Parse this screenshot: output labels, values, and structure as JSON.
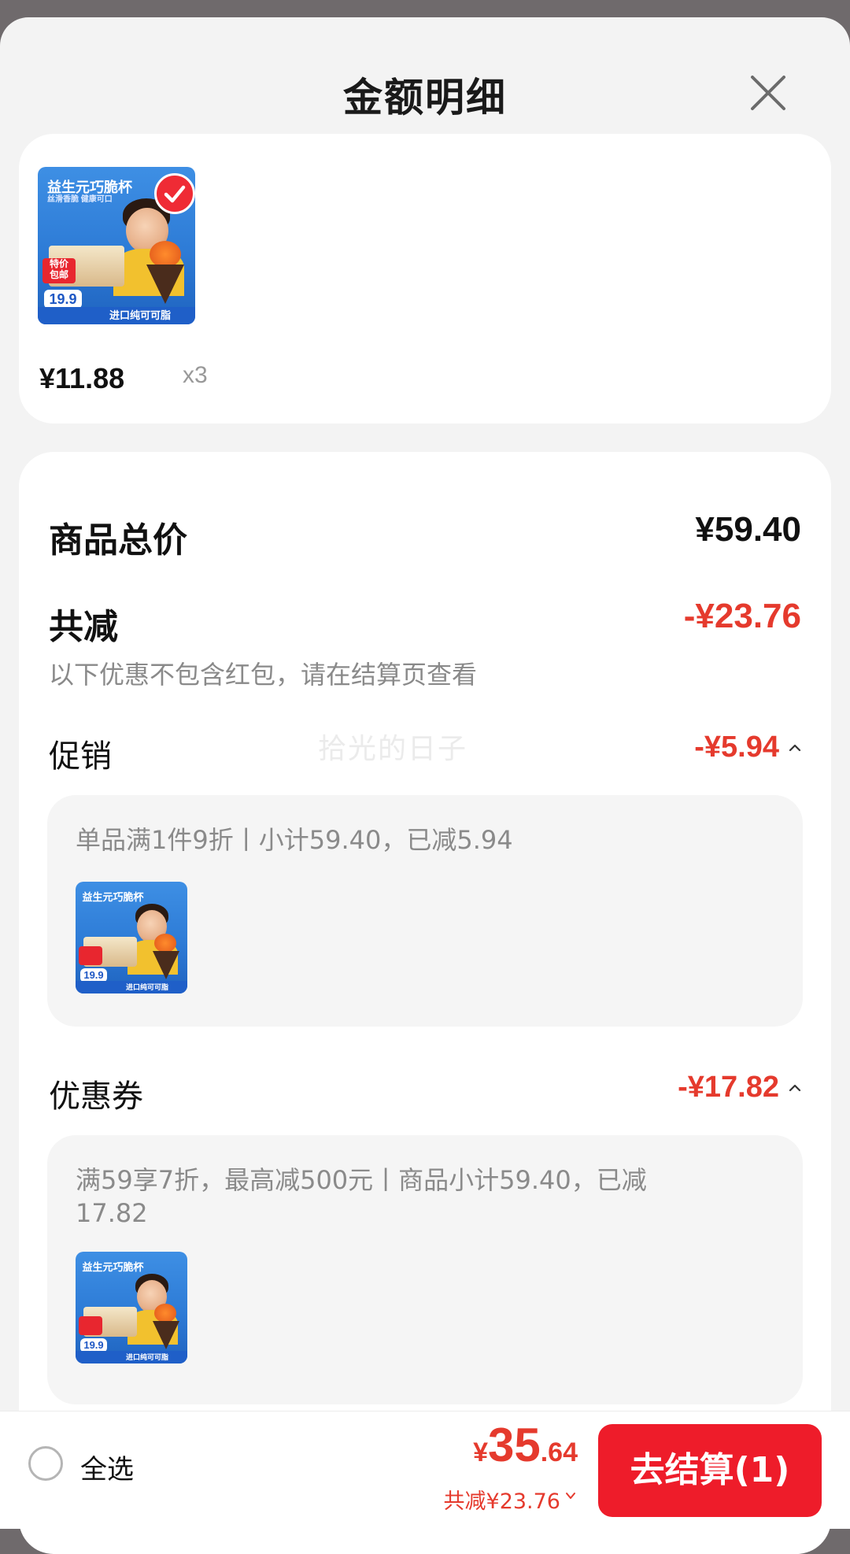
{
  "sheet": {
    "title": "金额明细"
  },
  "product_image": {
    "heading": "益生元巧脆杯",
    "sub": "丝滑香脆 健康可口",
    "tag": "特价\n包邮",
    "price": "19.9",
    "strip": "进口纯可可脂"
  },
  "products": [
    {
      "price": "¥11.88",
      "qty": "x3",
      "selected": true
    }
  ],
  "summary": {
    "total_label": "商品总价",
    "total_value": "¥59.40",
    "reduce_label": "共减",
    "reduce_value": "-¥23.76",
    "note": "以下优惠不包含红包，请在结算页查看"
  },
  "promotion": {
    "label": "促销",
    "value": "-¥5.94",
    "detail": "单品满1件9折丨小计59.40，已减5.94"
  },
  "coupon": {
    "label": "优惠券",
    "value": "-¥17.82",
    "detail": "满59享7折，最高减500元丨商品小计59.40，已减17.82"
  },
  "watermark": "拾光的日子",
  "bottom_bar": {
    "select_all": "全选",
    "currency": "¥",
    "amount_int": "35",
    "amount_dec": ".64",
    "total_reduce": "共减¥23.76",
    "checkout_label": "去结算(1)"
  },
  "colors": {
    "accent_red": "#e53a2d",
    "button_red": "#ee1c2a"
  }
}
